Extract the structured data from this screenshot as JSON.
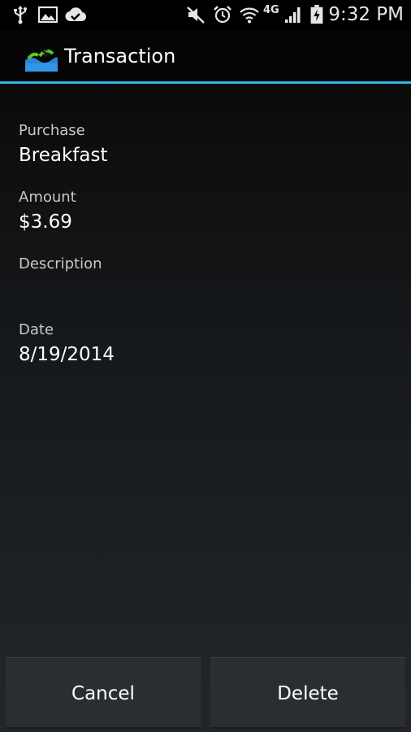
{
  "status_bar": {
    "time": "9:32 PM",
    "network_label": "4G",
    "icons": [
      "usb-icon",
      "image-icon",
      "cloud-check-icon",
      "mute-icon",
      "alarm-icon",
      "wifi-icon",
      "signal-icon",
      "battery-charging-icon"
    ]
  },
  "action_bar": {
    "title": "Transaction",
    "app_icon": "money-wave-icon"
  },
  "fields": {
    "purchase": {
      "label": "Purchase",
      "value": "Breakfast"
    },
    "amount": {
      "label": "Amount",
      "value": "$3.69"
    },
    "description": {
      "label": "Description",
      "value": ""
    },
    "date": {
      "label": "Date",
      "value": "8/19/2014"
    }
  },
  "buttons": {
    "cancel_label": "Cancel",
    "delete_label": "Delete"
  },
  "colors": {
    "accent": "#33b5e5",
    "background": "#000000",
    "icon_green": "#5cc71f",
    "icon_blue": "#2a86d6"
  }
}
